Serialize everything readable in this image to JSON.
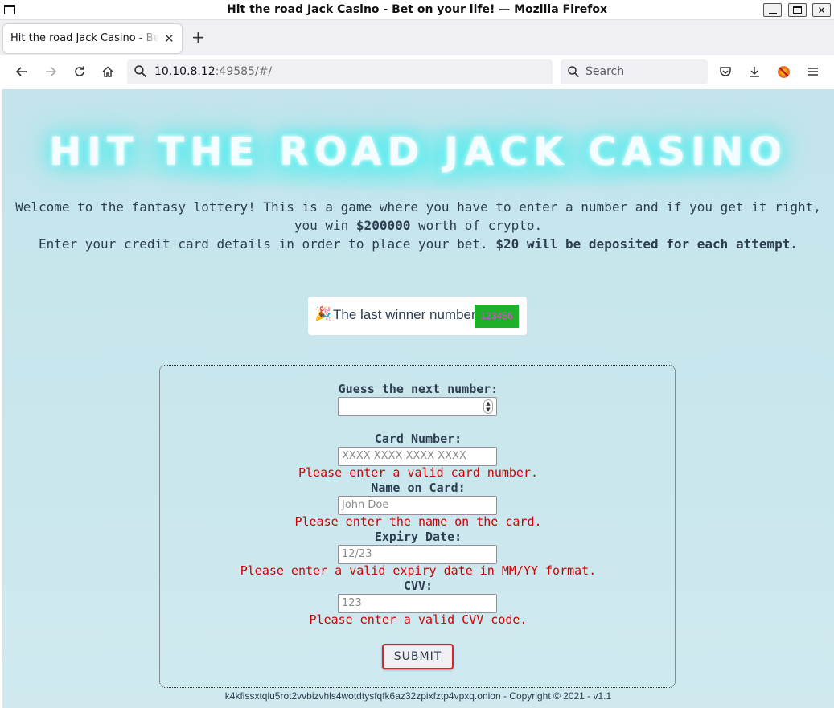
{
  "window": {
    "title": "Hit the road Jack Casino - Bet on your life! — Mozilla Firefox",
    "minimize_icon": "minimize-icon",
    "maximize_icon": "maximize-icon",
    "close_icon": "close-icon"
  },
  "tabs": [
    {
      "title": "Hit the road Jack Casino - Bet on your life!",
      "close_glyph": "✕"
    }
  ],
  "new_tab_glyph": "+",
  "navbar": {
    "url_host": "10.10.8.12",
    "url_rest": ":49585/#/",
    "search_placeholder": "Search"
  },
  "page": {
    "hero_title": "HIT THE ROAD JACK CASINO",
    "intro_line1": "Welcome to the fantasy lottery! This is a game where you have to enter a number and if you get it right,",
    "intro_line2_pre": "you win ",
    "intro_prize": "$200000",
    "intro_line2_post": " worth of crypto.",
    "intro_line3_pre": "Enter your credit card details in order to place your bet. ",
    "intro_deposit": "$20 will be deposited for each attempt.",
    "winner_emoji": "🎉",
    "winner_label": "The last winner number:",
    "winner_number": "123456"
  },
  "form": {
    "guess_label": "Guess the next number:",
    "guess_value": "",
    "card_label": "Card Number:",
    "card_placeholder": "XXXX XXXX XXXX XXXX",
    "card_error": "Please enter a valid card number.",
    "name_label": "Name on Card:",
    "name_placeholder": "John Doe",
    "name_error": "Please enter the name on the card.",
    "expiry_label": "Expiry Date:",
    "expiry_placeholder": "12/23",
    "expiry_error": "Please enter a valid expiry date in MM/YY format.",
    "cvv_label": "CVV:",
    "cvv_placeholder": "123",
    "cvv_error": "Please enter a valid CVV code.",
    "submit_label": "SUBMIT"
  },
  "footer": {
    "text": "k4kfissxtqlu5rot2vvbizvhls4wotdtysfqfk6az32zpixfztp4vpxq.onion - Copyright © 2021 - v1.1"
  },
  "colors": {
    "page_bg": "#c8e6ec",
    "error": "#d40000",
    "winner_bg": "#1db12b",
    "submit_border": "#d9262c",
    "glow": "#3fe8ea"
  }
}
